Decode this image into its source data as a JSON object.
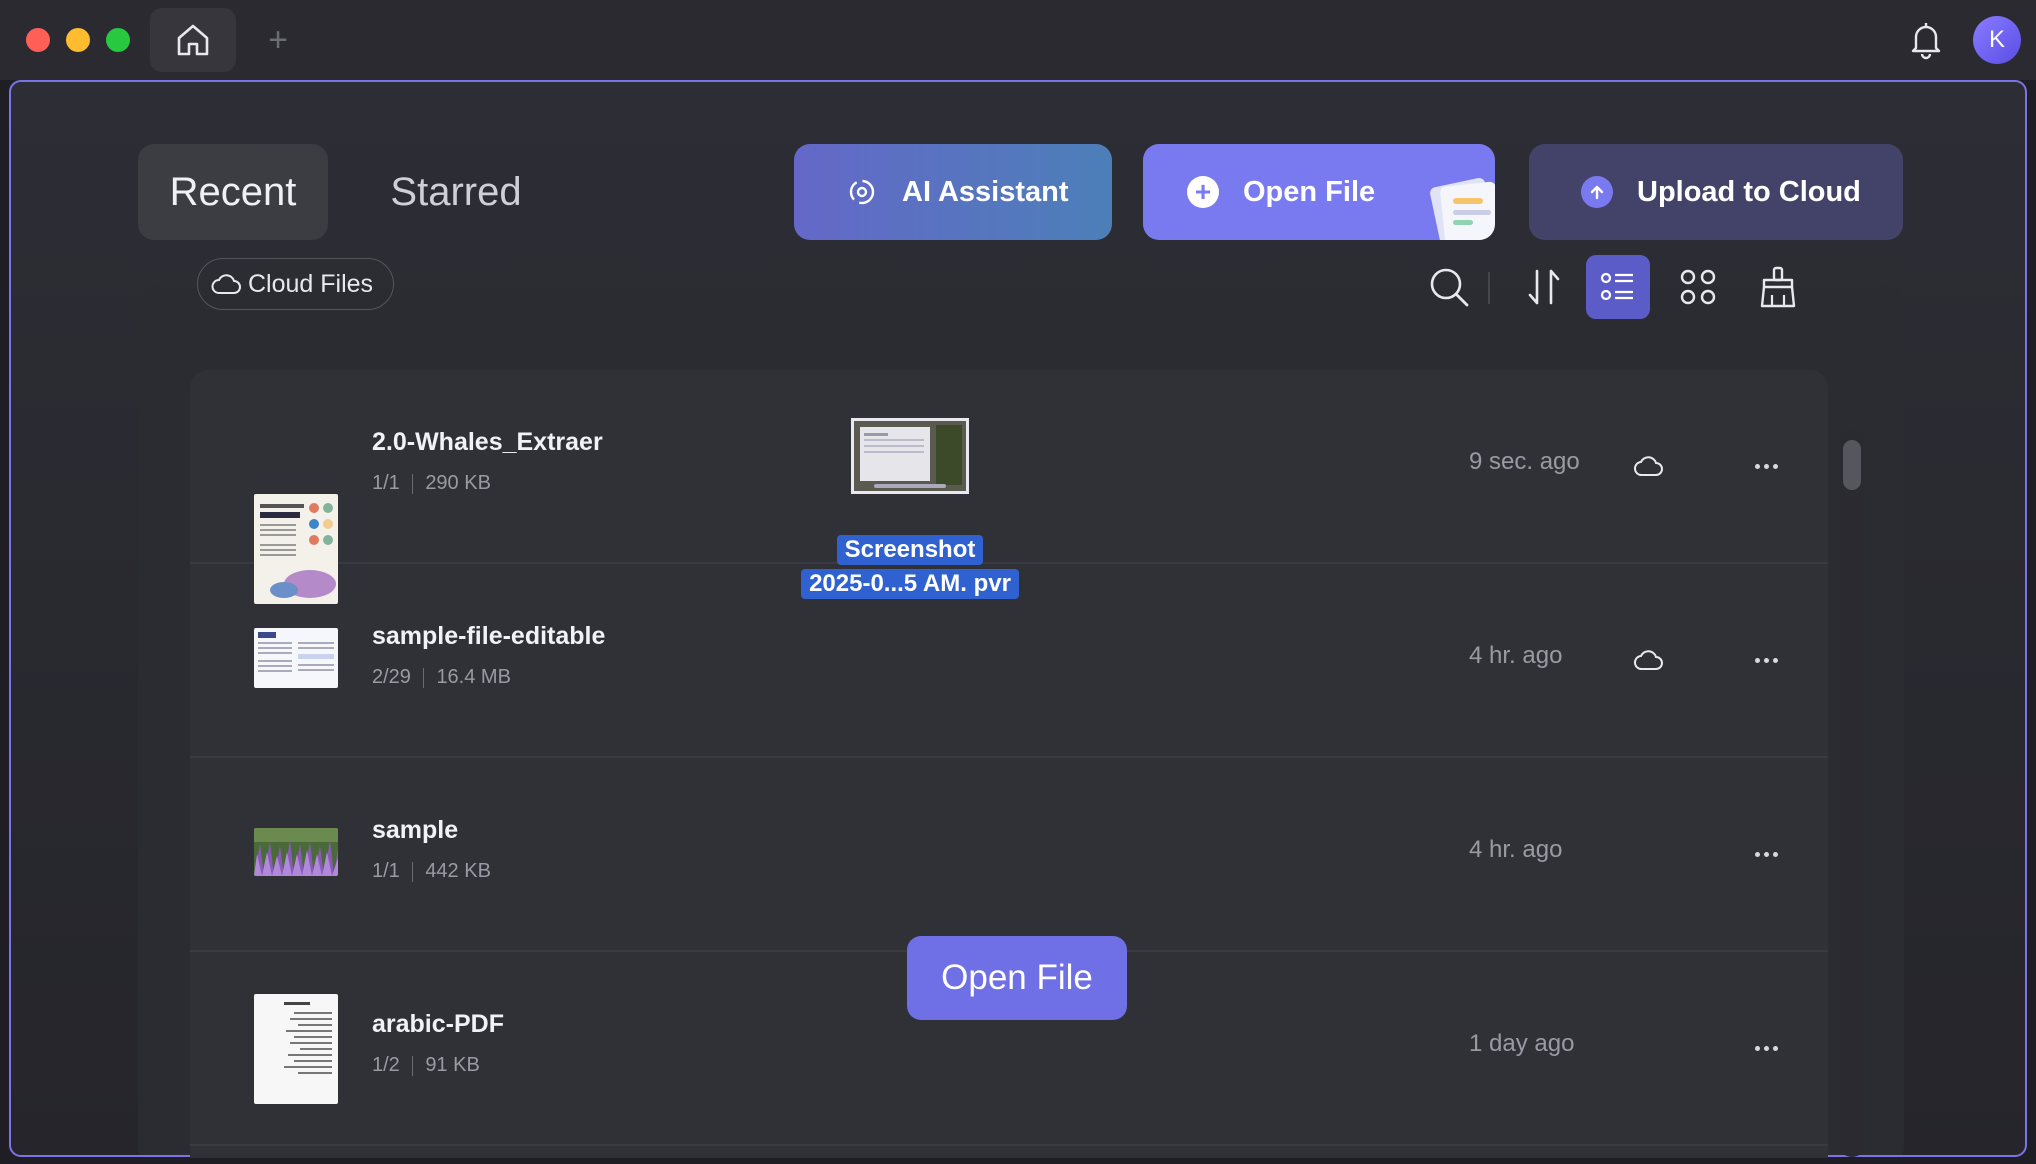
{
  "window": {
    "new_tab_label": "+",
    "avatar_initial": "K"
  },
  "tabs": {
    "recent": "Recent",
    "starred": "Starred"
  },
  "actions": {
    "ai_assistant": "AI Assistant",
    "open_file": "Open File",
    "upload_to_cloud": "Upload to Cloud"
  },
  "toolbar": {
    "cloud_files": "Cloud Files"
  },
  "files": [
    {
      "name": "2.0-Whales_Extraer",
      "pages": "1/1",
      "size": "290 KB",
      "time": "9 sec. ago",
      "cloud": true
    },
    {
      "name": "sample-file-editable",
      "pages": "2/29",
      "size": "16.4 MB",
      "time": "4 hr. ago",
      "cloud": true
    },
    {
      "name": "sample",
      "pages": "1/1",
      "size": "442 KB",
      "time": "4 hr. ago",
      "cloud": false
    },
    {
      "name": "arabic-PDF",
      "pages": "1/2",
      "size": "91 KB",
      "time": "1 day ago",
      "cloud": false
    }
  ],
  "drag": {
    "line1": "Screenshot",
    "line2": "2025-0...5 AM. pvr"
  },
  "drop_overlay": {
    "label": "Open File"
  },
  "colors": {
    "accent": "#7a7af0",
    "frame_border": "#7b74e6",
    "selection": "#2f62d0"
  }
}
